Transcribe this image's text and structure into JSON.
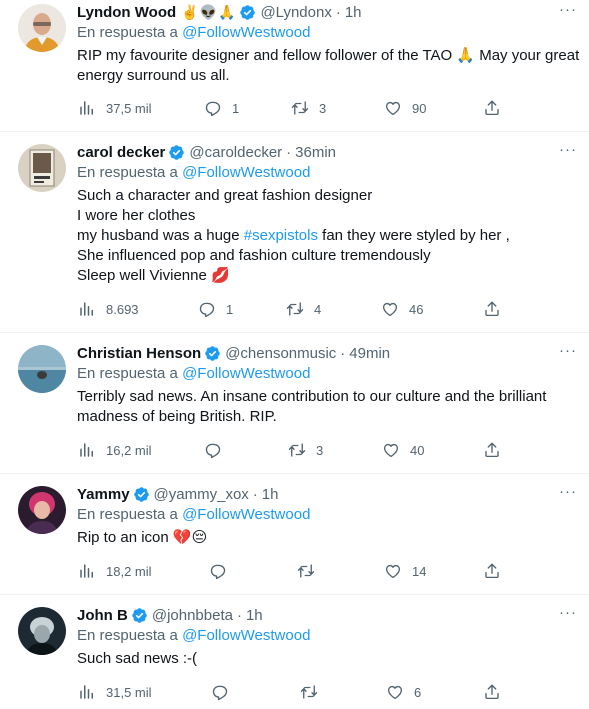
{
  "reply_prefix": "En respuesta a",
  "tweets": [
    {
      "name": "Lyndon Wood",
      "name_emoji": "✌️👽🙏",
      "handle": "@Lyndonx",
      "time": "1h",
      "reply_to": "@FollowWestwood",
      "lines": [
        "RIP my favourite designer and fellow follower of the TAO 🙏 May your great",
        "energy surround us all."
      ],
      "views": "37,5 mil",
      "replies": "1",
      "retweets": "3",
      "likes": "90"
    },
    {
      "name": "carol decker",
      "handle": "@caroldecker",
      "time": "36min",
      "reply_to": "@FollowWestwood",
      "lines": [
        "Such a character and great fashion designer",
        "I wore her clothes",
        "my husband was a huge ",
        "She influenced pop and fashion culture tremendously",
        "Sleep well Vivienne 💋"
      ],
      "hashtag": "#sexpistols",
      "line3_suffix": " fan they were styled by her ,",
      "views": "8.693",
      "replies": "1",
      "retweets": "4",
      "likes": "46"
    },
    {
      "name": "Christian Henson",
      "handle": "@chensonmusic",
      "time": "49min",
      "reply_to": "@FollowWestwood",
      "lines": [
        "Terribly sad news. An insane contribution to our culture and the brilliant",
        "madness of being British. RIP."
      ],
      "views": "16,2 mil",
      "replies": "",
      "retweets": "3",
      "likes": "40"
    },
    {
      "name": "Yammy",
      "handle": "@yammy_xox",
      "time": "1h",
      "reply_to": "@FollowWestwood",
      "lines": [
        "Rip to an icon 💔😔"
      ],
      "views": "18,2 mil",
      "replies": "",
      "retweets": "",
      "likes": "14"
    },
    {
      "name": "John B",
      "handle": "@johnbbeta",
      "time": "1h",
      "reply_to": "@FollowWestwood",
      "lines": [
        "Such sad news :-("
      ],
      "views": "31,5 mil",
      "replies": "",
      "retweets": "",
      "likes": "6"
    }
  ],
  "colors": {
    "accent": "#1d9bf0",
    "muted": "#536471",
    "text": "#0f1419",
    "divider": "#eff3f4"
  },
  "icons": [
    "views-icon",
    "reply-icon",
    "retweet-icon",
    "like-icon",
    "share-icon",
    "verified-badge-icon",
    "more-icon"
  ]
}
